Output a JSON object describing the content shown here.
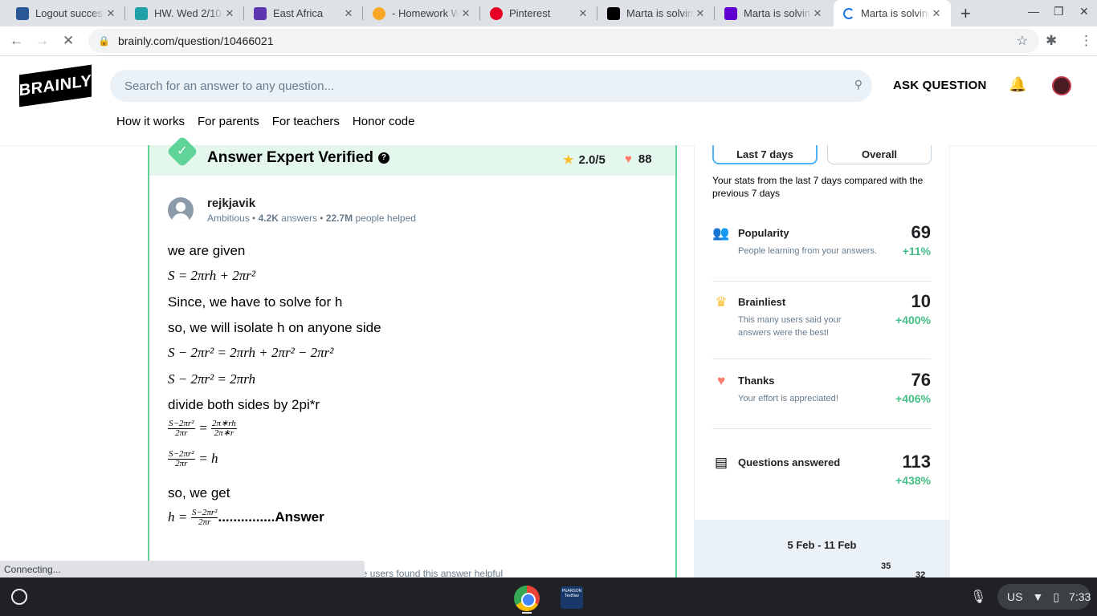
{
  "browser": {
    "tabs": [
      {
        "title": "Logout success",
        "favicon_color": "#2b5797"
      },
      {
        "title": "HW. Wed 2/10",
        "favicon_color": "#1fa1a8"
      },
      {
        "title": "East Africa",
        "favicon_color": "#5e35b1"
      },
      {
        "title": "- Homework We",
        "favicon_color": "#f9a825"
      },
      {
        "title": "Pinterest",
        "favicon_color": "#e60023"
      },
      {
        "title": "Marta is solving",
        "favicon_color": "#000000"
      },
      {
        "title": "Marta is solving",
        "favicon_color": "#6001d2"
      },
      {
        "title": "Marta is solving",
        "favicon_color": "#1a73e8"
      }
    ],
    "url": "brainly.com/question/10466021",
    "status_text": "Connecting..."
  },
  "header": {
    "logo_text": "BRAINLY",
    "search_placeholder": "Search for an answer to any question...",
    "ask_label": "ASK QUESTION",
    "nav": [
      "How it works",
      "For parents",
      "For teachers",
      "Honor code"
    ]
  },
  "answer": {
    "verified_title": "Answer Expert Verified",
    "rating": "2.0/5",
    "likes": "88",
    "author": {
      "name": "rejkjavik",
      "rank": "Ambitious",
      "answers_count": "4.2K",
      "answers_label": "answers",
      "helped_count": "22.7M",
      "helped_label": "people helped"
    },
    "lines": {
      "l1": "we are given",
      "l2": "S = 2πrh + 2πr²",
      "l3": "Since, we have to solve for h",
      "l4": "so, we will isolate h on anyone side",
      "l5": "S − 2πr² = 2πrh + 2πr² − 2πr²",
      "l6": "S − 2πr² = 2πrh",
      "l7": "divide both sides by 2pi*r",
      "l8_num_left": "S−2πr²",
      "l8_den_left": "2πr",
      "l8_num_right": "2π∗rh",
      "l8_den_right": "2π∗r",
      "l9_num": "S−2πr²",
      "l9_den": "2πr",
      "l9_rhs": "= h",
      "l10": "so, we get",
      "l11_lhs": "h =",
      "l11_num": "S−2πr²",
      "l11_den": "2πr",
      "l11_answer": "...............Answer"
    },
    "helpful_fragment": "ore users found this answer helpful"
  },
  "stats": {
    "tabs": [
      "Last 7 days",
      "Overall"
    ],
    "description": "Your stats from the last 7 days compared with the previous 7 days",
    "items": [
      {
        "title": "Popularity",
        "desc": "People learning from your answers.",
        "value": "69",
        "change": "+11%"
      },
      {
        "title": "Brainliest",
        "desc": "This many users said your answers were the best!",
        "value": "10",
        "change": "+400%"
      },
      {
        "title": "Thanks",
        "desc": "Your effort is appreciated!",
        "value": "76",
        "change": "+406%"
      },
      {
        "title": "Questions answered",
        "desc": "",
        "value": "113",
        "change": "+438%"
      }
    ],
    "week_label": "5 Feb - 11 Feb",
    "bar_value_1": "35",
    "bar_value_2": "32"
  },
  "shelf": {
    "pearson_label": "PEARSON TestNav",
    "locale": "US",
    "time": "7:33"
  }
}
